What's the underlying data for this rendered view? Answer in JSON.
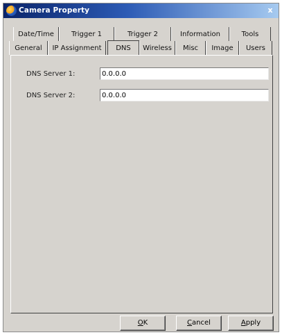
{
  "window": {
    "title": "Camera Property",
    "close_glyph": "x",
    "icon": "camera-app-icon"
  },
  "tabs": {
    "back_row": [
      "Date/Time",
      "Trigger 1",
      "Trigger 2",
      "Information",
      "Tools"
    ],
    "front_row": [
      "General",
      "IP Assignment",
      "DNS",
      "Wireless",
      "Misc",
      "Image",
      "Users"
    ],
    "selected": "DNS"
  },
  "dns": {
    "server1": {
      "label": "DNS Server 1:",
      "value": "0.0.0.0"
    },
    "server2": {
      "label": "DNS Server 2:",
      "value": "0.0.0.0"
    }
  },
  "buttons": {
    "ok": {
      "mnemonic": "O",
      "rest": "K"
    },
    "cancel": {
      "mnemonic": "C",
      "rest": "ancel"
    },
    "apply": {
      "mnemonic": "A",
      "rest": "pply"
    }
  }
}
